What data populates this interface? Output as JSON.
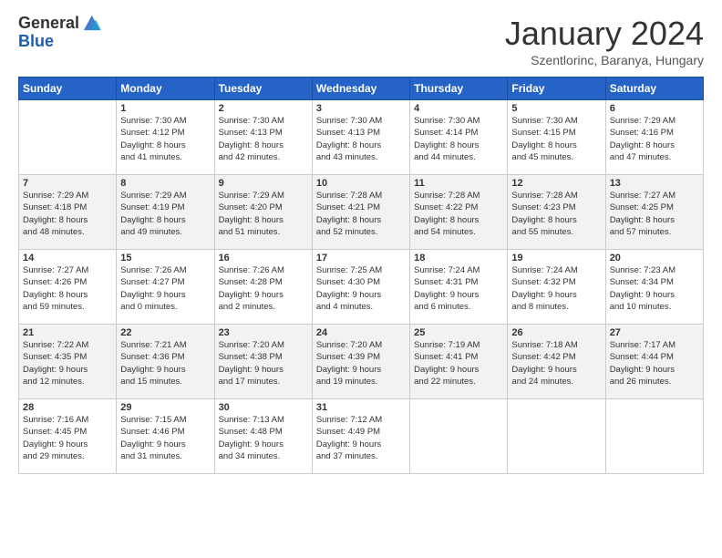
{
  "logo": {
    "general": "General",
    "blue": "Blue"
  },
  "header": {
    "title": "January 2024",
    "subtitle": "Szentlorinc, Baranya, Hungary"
  },
  "weekdays": [
    "Sunday",
    "Monday",
    "Tuesday",
    "Wednesday",
    "Thursday",
    "Friday",
    "Saturday"
  ],
  "weeks": [
    [
      {
        "day": "",
        "sunrise": "",
        "sunset": "",
        "daylight": ""
      },
      {
        "day": "1",
        "sunrise": "Sunrise: 7:30 AM",
        "sunset": "Sunset: 4:12 PM",
        "daylight": "Daylight: 8 hours and 41 minutes."
      },
      {
        "day": "2",
        "sunrise": "Sunrise: 7:30 AM",
        "sunset": "Sunset: 4:13 PM",
        "daylight": "Daylight: 8 hours and 42 minutes."
      },
      {
        "day": "3",
        "sunrise": "Sunrise: 7:30 AM",
        "sunset": "Sunset: 4:13 PM",
        "daylight": "Daylight: 8 hours and 43 minutes."
      },
      {
        "day": "4",
        "sunrise": "Sunrise: 7:30 AM",
        "sunset": "Sunset: 4:14 PM",
        "daylight": "Daylight: 8 hours and 44 minutes."
      },
      {
        "day": "5",
        "sunrise": "Sunrise: 7:30 AM",
        "sunset": "Sunset: 4:15 PM",
        "daylight": "Daylight: 8 hours and 45 minutes."
      },
      {
        "day": "6",
        "sunrise": "Sunrise: 7:29 AM",
        "sunset": "Sunset: 4:16 PM",
        "daylight": "Daylight: 8 hours and 47 minutes."
      }
    ],
    [
      {
        "day": "7",
        "sunrise": "Sunrise: 7:29 AM",
        "sunset": "Sunset: 4:18 PM",
        "daylight": "Daylight: 8 hours and 48 minutes."
      },
      {
        "day": "8",
        "sunrise": "Sunrise: 7:29 AM",
        "sunset": "Sunset: 4:19 PM",
        "daylight": "Daylight: 8 hours and 49 minutes."
      },
      {
        "day": "9",
        "sunrise": "Sunrise: 7:29 AM",
        "sunset": "Sunset: 4:20 PM",
        "daylight": "Daylight: 8 hours and 51 minutes."
      },
      {
        "day": "10",
        "sunrise": "Sunrise: 7:28 AM",
        "sunset": "Sunset: 4:21 PM",
        "daylight": "Daylight: 8 hours and 52 minutes."
      },
      {
        "day": "11",
        "sunrise": "Sunrise: 7:28 AM",
        "sunset": "Sunset: 4:22 PM",
        "daylight": "Daylight: 8 hours and 54 minutes."
      },
      {
        "day": "12",
        "sunrise": "Sunrise: 7:28 AM",
        "sunset": "Sunset: 4:23 PM",
        "daylight": "Daylight: 8 hours and 55 minutes."
      },
      {
        "day": "13",
        "sunrise": "Sunrise: 7:27 AM",
        "sunset": "Sunset: 4:25 PM",
        "daylight": "Daylight: 8 hours and 57 minutes."
      }
    ],
    [
      {
        "day": "14",
        "sunrise": "Sunrise: 7:27 AM",
        "sunset": "Sunset: 4:26 PM",
        "daylight": "Daylight: 8 hours and 59 minutes."
      },
      {
        "day": "15",
        "sunrise": "Sunrise: 7:26 AM",
        "sunset": "Sunset: 4:27 PM",
        "daylight": "Daylight: 9 hours and 0 minutes."
      },
      {
        "day": "16",
        "sunrise": "Sunrise: 7:26 AM",
        "sunset": "Sunset: 4:28 PM",
        "daylight": "Daylight: 9 hours and 2 minutes."
      },
      {
        "day": "17",
        "sunrise": "Sunrise: 7:25 AM",
        "sunset": "Sunset: 4:30 PM",
        "daylight": "Daylight: 9 hours and 4 minutes."
      },
      {
        "day": "18",
        "sunrise": "Sunrise: 7:24 AM",
        "sunset": "Sunset: 4:31 PM",
        "daylight": "Daylight: 9 hours and 6 minutes."
      },
      {
        "day": "19",
        "sunrise": "Sunrise: 7:24 AM",
        "sunset": "Sunset: 4:32 PM",
        "daylight": "Daylight: 9 hours and 8 minutes."
      },
      {
        "day": "20",
        "sunrise": "Sunrise: 7:23 AM",
        "sunset": "Sunset: 4:34 PM",
        "daylight": "Daylight: 9 hours and 10 minutes."
      }
    ],
    [
      {
        "day": "21",
        "sunrise": "Sunrise: 7:22 AM",
        "sunset": "Sunset: 4:35 PM",
        "daylight": "Daylight: 9 hours and 12 minutes."
      },
      {
        "day": "22",
        "sunrise": "Sunrise: 7:21 AM",
        "sunset": "Sunset: 4:36 PM",
        "daylight": "Daylight: 9 hours and 15 minutes."
      },
      {
        "day": "23",
        "sunrise": "Sunrise: 7:20 AM",
        "sunset": "Sunset: 4:38 PM",
        "daylight": "Daylight: 9 hours and 17 minutes."
      },
      {
        "day": "24",
        "sunrise": "Sunrise: 7:20 AM",
        "sunset": "Sunset: 4:39 PM",
        "daylight": "Daylight: 9 hours and 19 minutes."
      },
      {
        "day": "25",
        "sunrise": "Sunrise: 7:19 AM",
        "sunset": "Sunset: 4:41 PM",
        "daylight": "Daylight: 9 hours and 22 minutes."
      },
      {
        "day": "26",
        "sunrise": "Sunrise: 7:18 AM",
        "sunset": "Sunset: 4:42 PM",
        "daylight": "Daylight: 9 hours and 24 minutes."
      },
      {
        "day": "27",
        "sunrise": "Sunrise: 7:17 AM",
        "sunset": "Sunset: 4:44 PM",
        "daylight": "Daylight: 9 hours and 26 minutes."
      }
    ],
    [
      {
        "day": "28",
        "sunrise": "Sunrise: 7:16 AM",
        "sunset": "Sunset: 4:45 PM",
        "daylight": "Daylight: 9 hours and 29 minutes."
      },
      {
        "day": "29",
        "sunrise": "Sunrise: 7:15 AM",
        "sunset": "Sunset: 4:46 PM",
        "daylight": "Daylight: 9 hours and 31 minutes."
      },
      {
        "day": "30",
        "sunrise": "Sunrise: 7:13 AM",
        "sunset": "Sunset: 4:48 PM",
        "daylight": "Daylight: 9 hours and 34 minutes."
      },
      {
        "day": "31",
        "sunrise": "Sunrise: 7:12 AM",
        "sunset": "Sunset: 4:49 PM",
        "daylight": "Daylight: 9 hours and 37 minutes."
      },
      {
        "day": "",
        "sunrise": "",
        "sunset": "",
        "daylight": ""
      },
      {
        "day": "",
        "sunrise": "",
        "sunset": "",
        "daylight": ""
      },
      {
        "day": "",
        "sunrise": "",
        "sunset": "",
        "daylight": ""
      }
    ]
  ]
}
